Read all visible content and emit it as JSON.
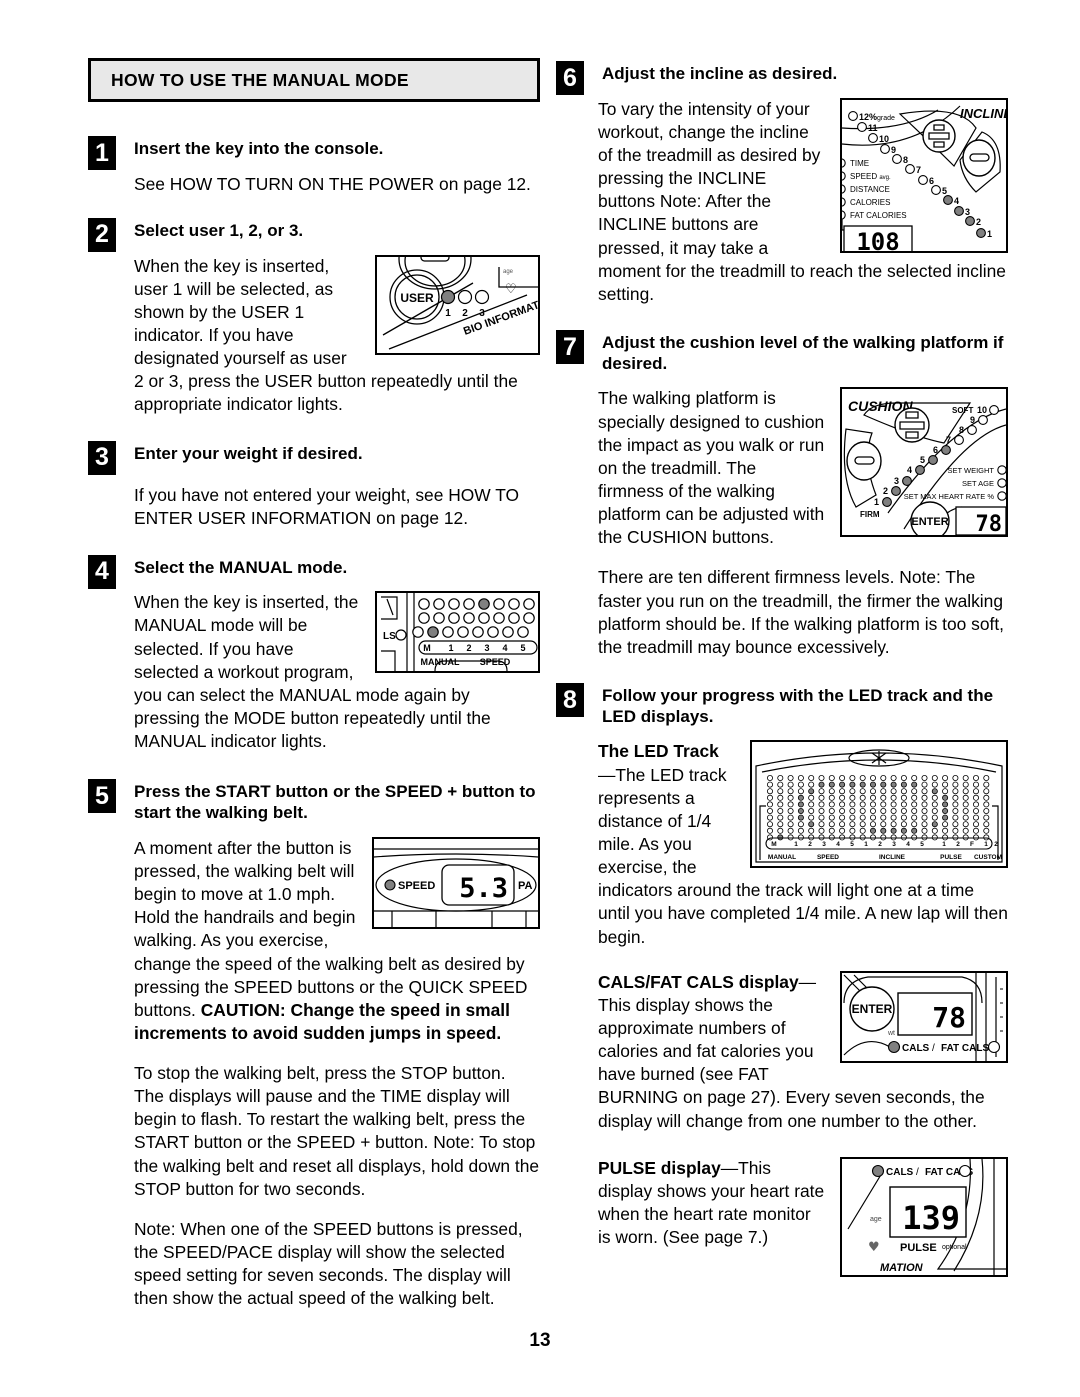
{
  "page": {
    "number": "13",
    "section_header": "HOW TO USE THE MANUAL MODE"
  },
  "steps_left": [
    {
      "num": "1",
      "title": "Insert the key into the console.",
      "body": "See HOW TO TURN ON THE POWER on page 12."
    },
    {
      "num": "2",
      "title": "Select user 1, 2, or 3.",
      "body": "When the key is inserted, user 1 will be selected, as shown by the USER 1 indicator. If you have designated yourself as user 2 or 3, press the USER button repeatedly until the appropriate indicator lights."
    },
    {
      "num": "3",
      "title": "Enter your weight if desired.",
      "body": "If you have not entered your weight, see HOW TO ENTER USER INFORMATION on page 12."
    },
    {
      "num": "4",
      "title": "Select the MANUAL mode.",
      "body": "When the key is inserted, the MANUAL mode will be selected. If you have selected a workout program, you can select the MANUAL mode again by pressing the MODE button repeatedly until the MANUAL indicator lights."
    },
    {
      "num": "5",
      "title": "Press the START button or the SPEED + button to start the walking belt.",
      "body_1_plain": "A moment after the button is pressed, the walking belt will begin to move at 1.0 mph. Hold the handrails and begin walking. As you exercise, change the speed of the walking belt as desired by pressing the SPEED buttons or the QUICK SPEED buttons. ",
      "body_1_bold": "CAUTION: Change the speed in small increments to avoid sudden jumps in speed.",
      "body_2": "To stop the walking belt, press the STOP button. The displays will pause and the TIME display will begin to flash. To restart the walking belt, press the START button or the SPEED + button. Note: To stop the walking belt and reset all displays, hold down the STOP button for two seconds.",
      "body_3": "Note: When one of the SPEED buttons is pressed, the SPEED/PACE display will show the selected speed setting for seven seconds. The display will then show the actual speed of the walking belt."
    }
  ],
  "steps_right": [
    {
      "num": "6",
      "title": "Adjust the incline as desired.",
      "body": "To vary the intensity of your workout, change the incline of the treadmill as desired by pressing the INCLINE buttons Note: After the INCLINE buttons are pressed, it may take a moment for the treadmill to reach the selected incline setting."
    },
    {
      "num": "7",
      "title": "Adjust the cushion level of the walking platform if desired.",
      "body_1": "The walking platform is specially designed to cushion the impact as you walk or run on the treadmill. The firmness of the walking platform can be adjusted with the CUSHION buttons.",
      "body_2": "There are ten different firmness levels. Note: The faster you run on the treadmill, the firmer the walking platform should be. If the walking platform is too soft, the treadmill may bounce excessively."
    },
    {
      "num": "8",
      "title": "Follow your progress with the LED track and the LED displays.",
      "sub_led_track": {
        "label_bold": "The LED Track",
        "dash": "—",
        "text": "The LED track represents a distance of 1/4 mile. As you exercise, the indicators around the track will light one at a time until you have completed 1/4 mile. A new lap will then begin."
      },
      "sub_cals": {
        "label_bold": "CALS/FAT CALS display",
        "dash": "—",
        "text": "This display shows the approximate numbers of calories and fat calories you have burned (see FAT BURNING on page 27). Every seven seconds, the display will change from one number to the other."
      },
      "sub_pulse": {
        "label_bold": "PULSE display",
        "dash": "—",
        "text": "This display shows your heart rate when the heart rate monitor is worn. (See page 7.)"
      }
    }
  ],
  "figures": {
    "user_panel": {
      "name": "user-indicator-figure",
      "button_label": "USER",
      "indicator_labels": [
        "1",
        "2",
        "3"
      ],
      "lit_indicator": "1",
      "bio_text": "BIO INFORMAT",
      "age_label": "age",
      "heart_icon": "heart-icon"
    },
    "manual_mode_panel": {
      "name": "manual-mode-led-figure",
      "side_label": "LS",
      "scale_labels": [
        "M",
        "1",
        "2",
        "3",
        "4",
        "5"
      ],
      "group_labels": [
        "MANUAL",
        "SPEED"
      ],
      "rows": 3,
      "cols": 8,
      "lit_cells": [
        [
          0,
          4
        ],
        [
          2,
          1
        ]
      ]
    },
    "speed_display": {
      "name": "speed-display-figure",
      "indicator_label": "SPEED",
      "value": "5.3",
      "right_label": "PA"
    },
    "incline_panel": {
      "name": "incline-panel-figure",
      "title": "INCLINE",
      "top_label": "12%",
      "top_label_small": "grade",
      "levels": [
        "11",
        "10",
        "9",
        "8",
        "7",
        "6",
        "5",
        "4",
        "3",
        "2",
        "1"
      ],
      "lit_levels": [
        "4",
        "3",
        "2",
        "1"
      ],
      "stat_labels": [
        "TIME",
        "SPEED avg.",
        "DISTANCE",
        "CALORIES",
        "FAT CALORIES"
      ],
      "display_value": "108",
      "plus_button": "plus-button",
      "minus_button": "minus-button"
    },
    "cushion_panel": {
      "name": "cushion-panel-figure",
      "title": "CUSHION",
      "soft_label": "SOFT",
      "soft_number": "10",
      "firm_label": "FIRM",
      "levels": [
        "9",
        "8",
        "7",
        "6",
        "5",
        "4",
        "3",
        "2",
        "1"
      ],
      "lit_levels": [
        "6",
        "5",
        "4",
        "3",
        "2",
        "1"
      ],
      "set_labels": [
        "SET WEIGHT",
        "SET AGE",
        "SET MAX HEART RATE %"
      ],
      "enter_button": "ENTER",
      "display_value": "78",
      "plus_button": "plus-button",
      "minus_button": "minus-button"
    },
    "led_track": {
      "name": "led-track-figure",
      "scale_labels": [
        "M",
        "1",
        "2",
        "3",
        "4",
        "5",
        "1",
        "2",
        "3",
        "4",
        "5",
        "1",
        "2",
        "F",
        "1",
        "2"
      ],
      "group_labels": [
        "MANUAL",
        "SPEED",
        "INCLINE",
        "PULSE",
        "CUSTOM"
      ],
      "rows": 10,
      "cols": 22
    },
    "cals_display": {
      "name": "cals-fat-cals-display-figure",
      "enter_button": "ENTER",
      "wt_label": "wt",
      "value": "78",
      "cals_label": "CALS",
      "slash": "/",
      "fat_cals_label": "FAT CALS"
    },
    "pulse_display": {
      "name": "pulse-display-figure",
      "cals_label": "CALS",
      "slash": "/",
      "fat_cals_label": "FAT CALS",
      "age_label": "age",
      "value": "139",
      "pulse_label": "PULSE",
      "optional_label": "optional",
      "bottom_text": "MATION",
      "heart_icon": "heart-icon"
    }
  },
  "colors": {
    "lit_led": "#808080",
    "unlit_led": "#ffffff",
    "header_bg": "#e8e8e8",
    "ink": "#000000"
  }
}
